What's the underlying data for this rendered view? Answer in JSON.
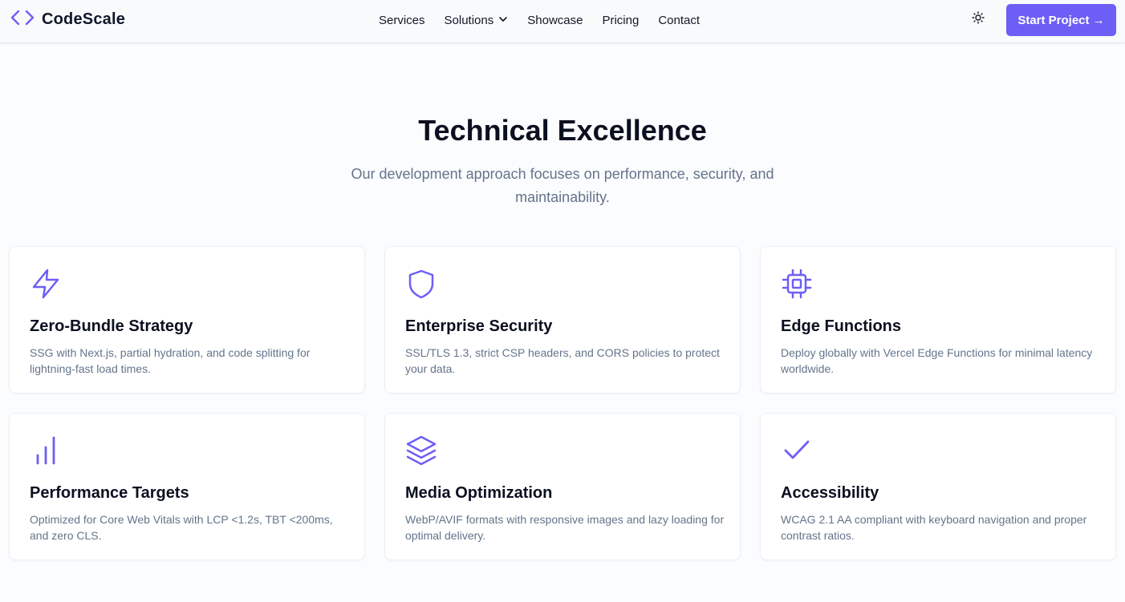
{
  "colors": {
    "accent": "#6d5ff5",
    "text": "#0f172a",
    "muted": "#64748b"
  },
  "brand": {
    "name": "CodeScale",
    "icon": "code-brackets-icon"
  },
  "nav": {
    "items": [
      {
        "label": "Services"
      },
      {
        "label": "Solutions",
        "has_dropdown": true
      },
      {
        "label": "Showcase"
      },
      {
        "label": "Pricing"
      },
      {
        "label": "Contact"
      }
    ],
    "theme_icon": "sun-icon",
    "cta_label": "Start Project →"
  },
  "hero": {
    "title": "Technical Excellence",
    "subtitle": "Our development approach focuses on performance, security, and maintainability."
  },
  "features": [
    {
      "icon": "lightning-icon",
      "title": "Zero-Bundle Strategy",
      "desc": "SSG with Next.js, partial hydration, and code splitting for lightning-fast load times."
    },
    {
      "icon": "shield-icon",
      "title": "Enterprise Security",
      "desc": "SSL/TLS 1.3, strict CSP headers, and CORS policies to protect your data."
    },
    {
      "icon": "chip-icon",
      "title": "Edge Functions",
      "desc": "Deploy globally with Vercel Edge Functions for minimal latency worldwide."
    },
    {
      "icon": "bar-chart-icon",
      "title": "Performance Targets",
      "desc": "Optimized for Core Web Vitals with LCP <1.2s, TBT <200ms, and zero CLS."
    },
    {
      "icon": "layers-icon",
      "title": "Media Optimization",
      "desc": "WebP/AVIF formats with responsive images and lazy loading for optimal delivery."
    },
    {
      "icon": "check-icon",
      "title": "Accessibility",
      "desc": "WCAG 2.1 AA compliant with keyboard navigation and proper contrast ratios."
    }
  ]
}
